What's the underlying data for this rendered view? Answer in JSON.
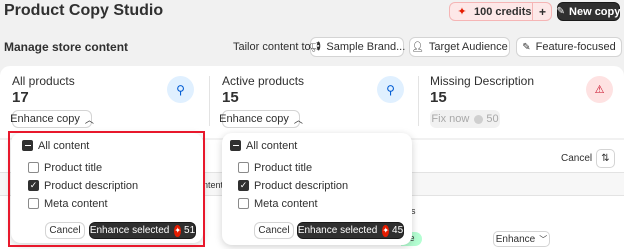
{
  "header": {
    "title": "Product Copy Studio",
    "credits_label": "100 credits",
    "credits_add_symbol": "+",
    "new_copy_label": "New copy"
  },
  "toolbar": {
    "section_title": "Manage store content",
    "tailor_label": "Tailor content to:",
    "sample_brand_label": "Sample Brand...",
    "target_audience_label": "Target Audience",
    "feature_focused_label": "Feature-focused"
  },
  "stats": [
    {
      "title": "All products",
      "value": "17",
      "action": "Enhance copy",
      "icon": "wand-icon"
    },
    {
      "title": "Active products",
      "value": "15",
      "action": "Enhance copy",
      "icon": "wand-icon"
    },
    {
      "title": "Missing Description",
      "value": "15",
      "action": "Fix now",
      "action_count": "50",
      "icon": "warning-icon"
    }
  ],
  "dropdown_left": {
    "all_label": "All content",
    "options": [
      {
        "label": "Product title",
        "checked": false
      },
      {
        "label": "Product description",
        "checked": true
      },
      {
        "label": "Meta content",
        "checked": false
      }
    ],
    "cancel_label": "Cancel",
    "enhance_label": "Enhance selected",
    "enhance_count": "51"
  },
  "dropdown_right": {
    "all_label": "All content",
    "options": [
      {
        "label": "Product title",
        "checked": false
      },
      {
        "label": "Product description",
        "checked": true
      },
      {
        "label": "Meta content",
        "checked": false
      }
    ],
    "cancel_label": "Cancel",
    "enhance_label": "Enhance selected",
    "enhance_count": "45"
  },
  "table": {
    "cancel_label": "Cancel",
    "fragment_content": "ntent",
    "fragment_s": "s",
    "fragment_status": "ve",
    "row_action_label": "Enhance"
  },
  "colors": {
    "accent_red": "#e51c00",
    "highlight_box": "#e8182c",
    "info_blue": "#e0f0ff",
    "warn_red": "#fee2e2"
  }
}
